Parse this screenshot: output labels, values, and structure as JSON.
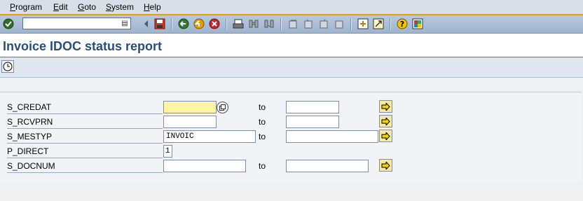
{
  "menu": {
    "items": [
      {
        "first": "P",
        "rest": "rogram"
      },
      {
        "first": "E",
        "rest": "dit"
      },
      {
        "first": "G",
        "rest": "oto"
      },
      {
        "first": "S",
        "rest": "ystem"
      },
      {
        "first": "H",
        "rest": "elp"
      }
    ]
  },
  "toolbar": {
    "command_value": ""
  },
  "title": "Invoice IDOC status report",
  "selection": {
    "rows": [
      {
        "label": "S_CREDAT",
        "from": "",
        "to_label": "to",
        "to": ""
      },
      {
        "label": "S_RCVPRN",
        "from": "",
        "to_label": "to",
        "to": ""
      },
      {
        "label": "S_MESTYP",
        "from": "INVOIC",
        "to_label": "to",
        "to": ""
      },
      {
        "label": "P_DIRECT",
        "from": "1"
      },
      {
        "label": "S_DOCNUM",
        "from": "",
        "to_label": "to",
        "to": ""
      }
    ]
  },
  "colors": {
    "menubar_bg": "#d9dfe9",
    "accent_line": "#e6a100",
    "title_color": "#2a4e7a",
    "required_field": "#fff4a3"
  }
}
